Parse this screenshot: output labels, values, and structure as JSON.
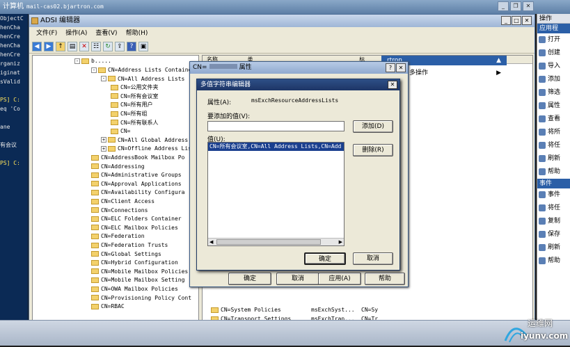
{
  "remote": {
    "title": "计算机",
    "host": "mail-cas02.bjartron.com"
  },
  "console": {
    "lines": [
      "ObjectC",
      "henCha",
      "henCre",
      "henCha",
      "henCre",
      "rganiz",
      "iginat",
      "sValid",
      "",
      "PS] C:",
      "eq 'Co",
      "",
      "ane",
      "",
      "有会议",
      "",
      "PS] C:"
    ]
  },
  "adsi": {
    "title": "ADSI 编辑器",
    "menu": [
      "文件(F)",
      "操作(A)",
      "查看(V)",
      "帮助(H)"
    ],
    "tree": [
      {
        "label": "CN=Address Lists Container",
        "indent": 1,
        "pm": "-"
      },
      {
        "label": "CN=All Address Lists",
        "indent": 2,
        "pm": "-"
      },
      {
        "label": "CN=公用文件夹",
        "indent": 3,
        "pm": ""
      },
      {
        "label": "CN=所有会议室",
        "indent": 3,
        "pm": ""
      },
      {
        "label": "CN=所有用户",
        "indent": 3,
        "pm": ""
      },
      {
        "label": "CN=所有组",
        "indent": 3,
        "pm": ""
      },
      {
        "label": "CN=所有联系人",
        "indent": 3,
        "pm": ""
      },
      {
        "label": "CN=",
        "indent": 3,
        "pm": ""
      },
      {
        "label": "CN=All Global Address",
        "indent": 2,
        "pm": "+"
      },
      {
        "label": "CN=Offline Address Lis",
        "indent": 2,
        "pm": "+"
      },
      {
        "label": "CN=AddressBook Mailbox Po",
        "indent": 1,
        "pm": ""
      },
      {
        "label": "CN=Addressing",
        "indent": 1,
        "pm": ""
      },
      {
        "label": "CN=Administrative Groups",
        "indent": 1,
        "pm": ""
      },
      {
        "label": "CN=Approval Applications",
        "indent": 1,
        "pm": ""
      },
      {
        "label": "CN=Availability Configura",
        "indent": 1,
        "pm": ""
      },
      {
        "label": "CN=Client Access",
        "indent": 1,
        "pm": ""
      },
      {
        "label": "CN=Connections",
        "indent": 1,
        "pm": ""
      },
      {
        "label": "CN=ELC Folders Container",
        "indent": 1,
        "pm": ""
      },
      {
        "label": "CN=ELC Mailbox Policies",
        "indent": 1,
        "pm": ""
      },
      {
        "label": "CN=Federation",
        "indent": 1,
        "pm": ""
      },
      {
        "label": "CN=Federation Trusts",
        "indent": 1,
        "pm": ""
      },
      {
        "label": "CN=Global Settings",
        "indent": 1,
        "pm": ""
      },
      {
        "label": "CN=Hybrid Configuration",
        "indent": 1,
        "pm": ""
      },
      {
        "label": "CN=Mobile Mailbox Policies",
        "indent": 1,
        "pm": ""
      },
      {
        "label": "CN=Mobile Mailbox Setting",
        "indent": 1,
        "pm": ""
      },
      {
        "label": "CN=OWA Mailbox Policies",
        "indent": 1,
        "pm": ""
      },
      {
        "label": "CN=Provisioning Policy Cont",
        "indent": 1,
        "pm": ""
      },
      {
        "label": "CN=RBAC",
        "indent": 1,
        "pm": ""
      }
    ],
    "list_header": [
      "名称",
      "类",
      "标"
    ],
    "list_rows": [
      {
        "name": "CN=System Policies",
        "cls": "msExchSyst...",
        "dn": "CN=Sy"
      },
      {
        "name": "CN=Transport Settings",
        "cls": "msExchTran...",
        "dn": "CN=Tr"
      }
    ],
    "right_pane": {
      "header": "rtron",
      "more": "多操作"
    }
  },
  "props": {
    "title_prefix": "CN=",
    "title_suffix": "属性",
    "buttons": {
      "ok": "确定",
      "cancel": "取消",
      "apply": "应用(A)",
      "help": "帮助"
    }
  },
  "mve": {
    "title": "多值字符串编辑器",
    "attribute_label": "属性(A):",
    "attribute_value": "msExchResourceAddressLists",
    "add_label": "要添加的值(V):",
    "add_value": "",
    "add_button": "添加(D)",
    "values_label": "值(U):",
    "values": [
      "CN=所有会议室,CN=All Address Lists,CN=Add"
    ],
    "remove_button": "删除(R)",
    "ok": "确定",
    "cancel": "取消"
  },
  "actions": {
    "header": "操作",
    "sub1": "应用程",
    "items1": [
      "打开",
      "创建",
      "导入",
      "添加",
      "筛选",
      "属性",
      "查看",
      "将所",
      "将任",
      "刷新",
      "帮助"
    ],
    "sub2": "事件",
    "items2": [
      "事件",
      "将任",
      "复制",
      "保存",
      "刷新",
      "帮助"
    ]
  },
  "watermark": {
    "text1": "运维网",
    "text2": "iyunv.com"
  }
}
